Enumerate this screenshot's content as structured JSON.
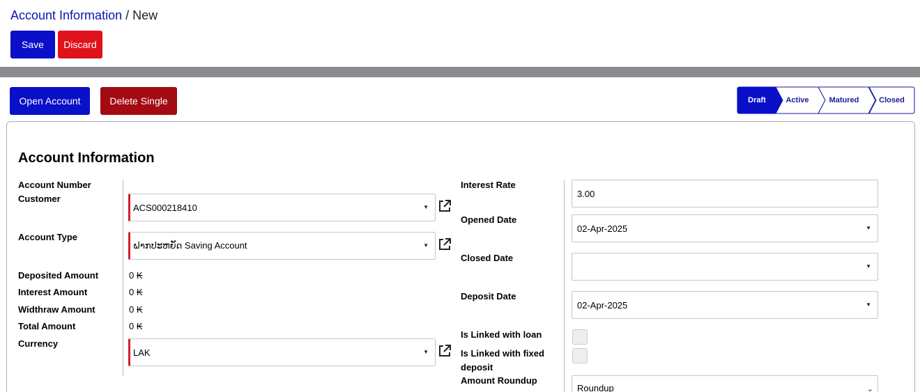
{
  "header": {
    "breadcrumb_link": "Account Information",
    "breadcrumb_sep": "/",
    "breadcrumb_current": "New",
    "save_label": "Save",
    "discard_label": "Discard"
  },
  "actions": {
    "open_label": "Open Account",
    "delete_label": "Delete Single"
  },
  "statusbar": {
    "steps": [
      "Draft",
      "Active",
      "Matured",
      "Closed"
    ],
    "active_step": "Draft"
  },
  "form": {
    "title": "Account Information",
    "left": {
      "account_number_label": "Account Number",
      "customer_label": "Customer",
      "customer_value": "ACS000218410",
      "account_type_label": "Account Type",
      "account_type_value": "ຝາກປະຫຍັດ Saving Account",
      "deposited_label": "Deposited Amount",
      "deposited_value": "0 ₭",
      "interest_label": "Interest Amount",
      "interest_value": "0 ₭",
      "withdraw_label": "Widthraw Amount",
      "withdraw_value": "0 ₭",
      "total_label": "Total Amount",
      "total_value": "0 ₭",
      "currency_label": "Currency",
      "currency_value": "LAK"
    },
    "right": {
      "interest_rate_label": "Interest Rate",
      "interest_rate_value": "3.00",
      "opened_date_label": "Opened Date",
      "opened_date_value": "02-Apr-2025",
      "closed_date_label": "Closed Date",
      "closed_date_value": "",
      "deposit_date_label": "Deposit Date",
      "deposit_date_value": "02-Apr-2025",
      "linked_loan_label": "Is Linked with loan",
      "linked_fixed_label": "Is Linked with fixed deposit",
      "roundup_label": "Amount Roundup",
      "roundup_value": "Roundup"
    }
  },
  "colors": {
    "primary": "#0a0fc8",
    "danger": "#e0121a",
    "dark_danger": "#a30a12",
    "link": "#0a14b0",
    "required_border": "#d0202a"
  }
}
